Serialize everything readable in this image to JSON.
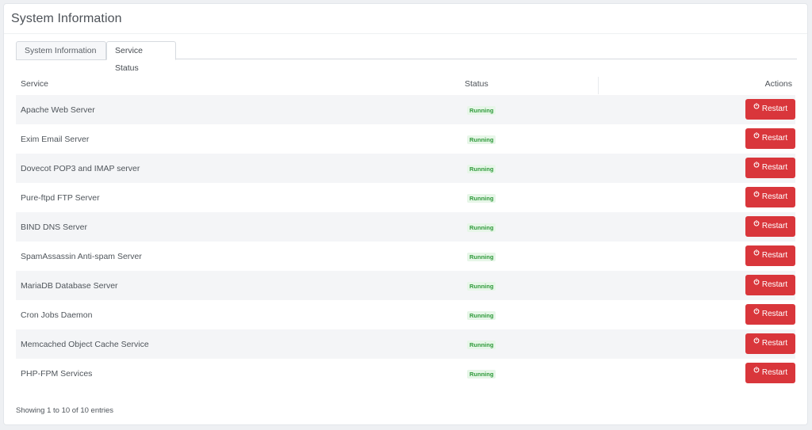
{
  "panel": {
    "title": "System Information"
  },
  "tabs": [
    {
      "label": "System Information",
      "active": false
    },
    {
      "label": "Service Status",
      "active": true
    }
  ],
  "table": {
    "headers": {
      "service": "Service",
      "status": "Status",
      "actions": "Actions"
    },
    "rows": [
      {
        "service": "Apache Web Server",
        "status": "Running",
        "action": "Restart"
      },
      {
        "service": "Exim Email Server",
        "status": "Running",
        "action": "Restart"
      },
      {
        "service": "Dovecot POP3 and IMAP server",
        "status": "Running",
        "action": "Restart"
      },
      {
        "service": "Pure-ftpd FTP Server",
        "status": "Running",
        "action": "Restart"
      },
      {
        "service": "BIND DNS Server",
        "status": "Running",
        "action": "Restart"
      },
      {
        "service": "SpamAssassin Anti-spam Server",
        "status": "Running",
        "action": "Restart"
      },
      {
        "service": "MariaDB Database Server",
        "status": "Running",
        "action": "Restart"
      },
      {
        "service": "Cron Jobs Daemon",
        "status": "Running",
        "action": "Restart"
      },
      {
        "service": "Memcached Object Cache Service",
        "status": "Running",
        "action": "Restart"
      },
      {
        "service": "PHP-FPM Services",
        "status": "Running",
        "action": "Restart"
      }
    ]
  },
  "footer": {
    "info": "Showing 1 to 10 of 10 entries"
  },
  "colors": {
    "restart_button": "#d9363b",
    "status_running_text": "#2e9a3a",
    "status_running_bg": "#e7f6e8"
  },
  "icons": {
    "restart": "power-icon"
  }
}
